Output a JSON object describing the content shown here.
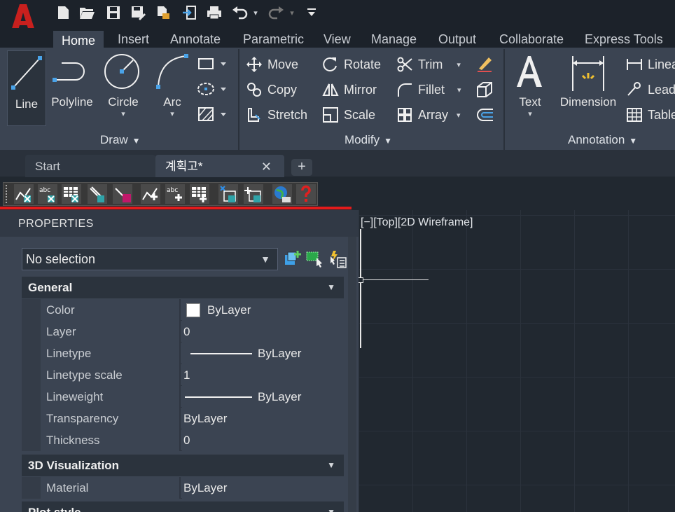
{
  "app": {
    "logo_letter": "A",
    "brand_color": "#c8201e"
  },
  "ribbon_tabs": [
    "Home",
    "Insert",
    "Annotate",
    "Parametric",
    "View",
    "Manage",
    "Output",
    "Collaborate",
    "Express Tools"
  ],
  "ribbon": {
    "draw": {
      "title": "Draw",
      "line": "Line",
      "polyline": "Polyline",
      "circle": "Circle",
      "arc": "Arc"
    },
    "modify": {
      "title": "Modify",
      "move": "Move",
      "rotate": "Rotate",
      "trim": "Trim",
      "copy": "Copy",
      "mirror": "Mirror",
      "fillet": "Fillet",
      "stretch": "Stretch",
      "scale": "Scale",
      "array": "Array"
    },
    "annotation": {
      "title": "Annotation",
      "text": "Text",
      "dimension": "Dimension",
      "linear": "Linea",
      "leader": "Lead",
      "table": "Table"
    }
  },
  "doc_tabs": {
    "start": "Start",
    "active": "계획고*",
    "close": "✕",
    "add": "+"
  },
  "viewport": {
    "label": "[−][Top][2D Wireframe]"
  },
  "properties": {
    "title": "PROPERTIES",
    "selection": "No selection",
    "groups": {
      "general": {
        "title": "General",
        "rows": [
          {
            "name": "Color",
            "value": "ByLayer"
          },
          {
            "name": "Layer",
            "value": "0"
          },
          {
            "name": "Linetype",
            "value": "ByLayer"
          },
          {
            "name": "Linetype scale",
            "value": "1"
          },
          {
            "name": "Lineweight",
            "value": "ByLayer"
          },
          {
            "name": "Transparency",
            "value": "ByLayer"
          },
          {
            "name": "Thickness",
            "value": "0"
          }
        ]
      },
      "visualization": {
        "title": "3D Visualization",
        "rows": [
          {
            "name": "Material",
            "value": "ByLayer"
          }
        ]
      },
      "plot": {
        "title": "Plot style"
      }
    }
  }
}
